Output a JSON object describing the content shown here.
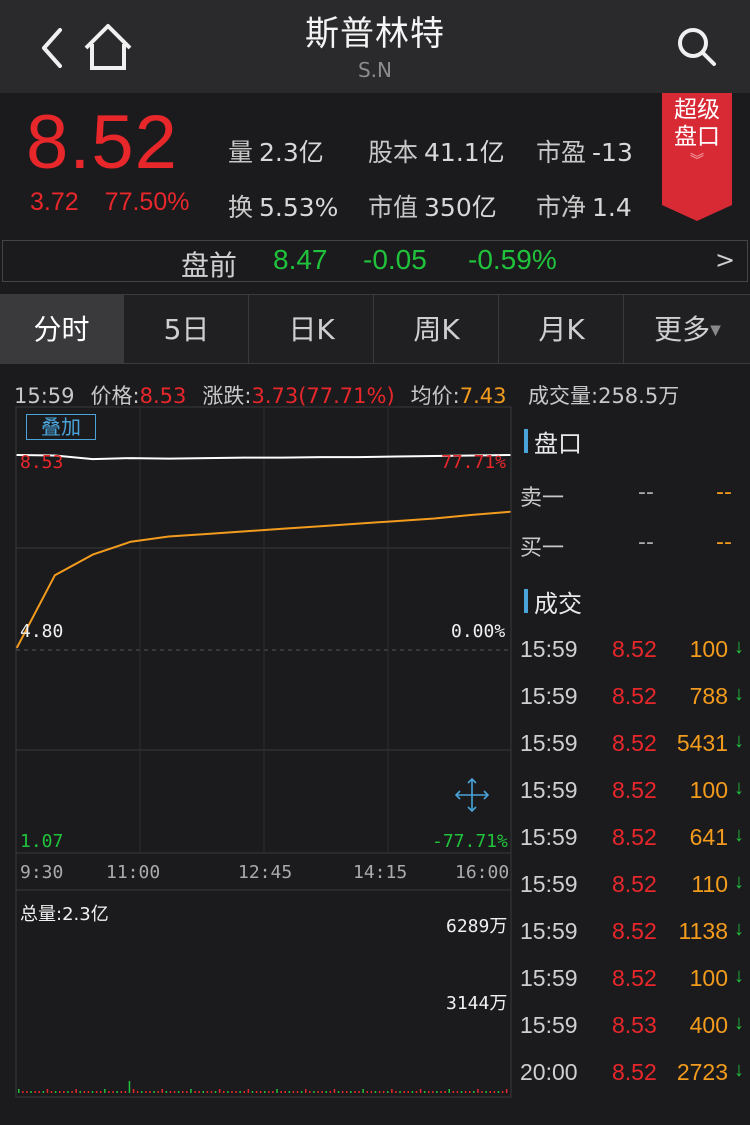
{
  "header": {
    "title": "斯普林特",
    "ticker": "S.N"
  },
  "quote": {
    "price": "8.52",
    "change": "3.72",
    "change_pct": "77.50%",
    "stats": [
      {
        "label": "量",
        "value": "2.3亿"
      },
      {
        "label": "股本",
        "value": "41.1亿"
      },
      {
        "label": "市盈",
        "value": "-13"
      },
      {
        "label": "换",
        "value": "5.53%"
      },
      {
        "label": "市值",
        "value": "350亿"
      },
      {
        "label": "市净",
        "value": "1.4"
      }
    ],
    "badge_line1": "超级",
    "badge_line2": "盘口"
  },
  "premarket": {
    "label": "盘前",
    "price": "8.47",
    "change": "-0.05",
    "change_pct": "-0.59%",
    "arrow": ">"
  },
  "tabs": [
    {
      "label": "分时",
      "active": true
    },
    {
      "label": "5日",
      "active": false
    },
    {
      "label": "日K",
      "active": false
    },
    {
      "label": "周K",
      "active": false
    },
    {
      "label": "月K",
      "active": false
    },
    {
      "label": "更多",
      "active": false
    }
  ],
  "chart_info": {
    "time": "15:59",
    "price_label": "价格:",
    "price": "8.53",
    "change_label": "涨跌:",
    "change": "3.73(77.71%)",
    "avg_label": "均价:",
    "avg": "7.43",
    "volume_label": "成交量:",
    "volume": "258.5万"
  },
  "overlay_button": "叠加",
  "axis": {
    "top_left": "8.53",
    "top_right": "77.71%",
    "mid_left": "4.80",
    "mid_right": "0.00%",
    "bottom_left": "1.07",
    "bottom_right": "-77.71%",
    "time_ticks": [
      "9:30",
      "11:00",
      "12:45",
      "14:15",
      "16:00"
    ],
    "vol_total": "总量:2.3亿",
    "vol_high": "6289万",
    "vol_mid": "3144万"
  },
  "chart_data": {
    "type": "line",
    "x": [
      "9:30",
      "10:00",
      "10:30",
      "11:00",
      "11:30",
      "12:00",
      "12:30",
      "13:00",
      "13:30",
      "14:00",
      "14:30",
      "15:00",
      "15:30",
      "16:00"
    ],
    "ylim": [
      1.07,
      8.53
    ],
    "series": [
      {
        "values": [
          8.53,
          8.52,
          8.45,
          8.47,
          8.46,
          8.47,
          8.48,
          8.48,
          8.49,
          8.49,
          8.5,
          8.51,
          8.52,
          8.53
        ],
        "color": "#ffffff"
      },
      {
        "values": [
          4.8,
          6.2,
          6.6,
          6.85,
          6.95,
          7.0,
          7.05,
          7.1,
          7.15,
          7.2,
          7.25,
          7.3,
          7.37,
          7.43
        ],
        "color": "#f29b1d"
      }
    ],
    "grid": true
  },
  "orderbook": {
    "title": "盘口",
    "rows": [
      {
        "label": "卖一",
        "a": "--",
        "b": "--"
      },
      {
        "label": "买一",
        "a": "--",
        "b": "--"
      }
    ]
  },
  "trades": {
    "title": "成交",
    "rows": [
      {
        "time": "15:59",
        "price": "8.52",
        "vol": "100",
        "arrow": "↓"
      },
      {
        "time": "15:59",
        "price": "8.52",
        "vol": "788",
        "arrow": "↓"
      },
      {
        "time": "15:59",
        "price": "8.52",
        "vol": "5431",
        "arrow": "↓"
      },
      {
        "time": "15:59",
        "price": "8.52",
        "vol": "100",
        "arrow": "↓"
      },
      {
        "time": "15:59",
        "price": "8.52",
        "vol": "641",
        "arrow": "↓"
      },
      {
        "time": "15:59",
        "price": "8.52",
        "vol": "110",
        "arrow": "↓"
      },
      {
        "time": "15:59",
        "price": "8.52",
        "vol": "1138",
        "arrow": "↓"
      },
      {
        "time": "15:59",
        "price": "8.52",
        "vol": "100",
        "arrow": "↓"
      },
      {
        "time": "15:59",
        "price": "8.53",
        "vol": "400",
        "arrow": "↓"
      },
      {
        "time": "20:00",
        "price": "8.52",
        "vol": "2723",
        "arrow": "↓"
      }
    ]
  }
}
